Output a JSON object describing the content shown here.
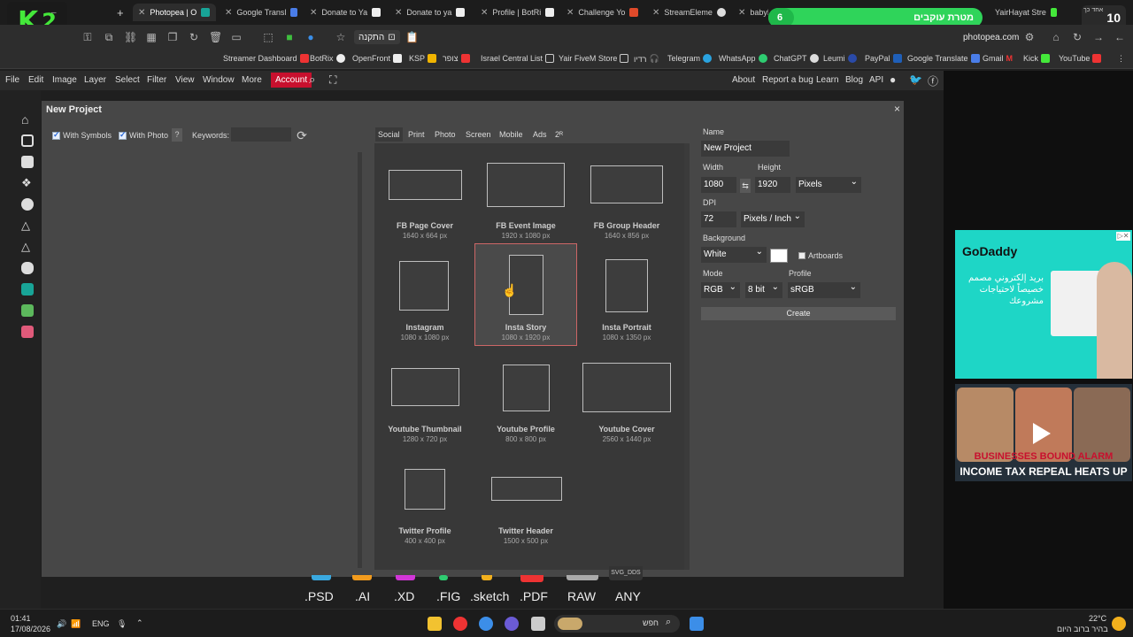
{
  "browser": {
    "tabs": [
      {
        "title": "Photopea | O",
        "active": true
      },
      {
        "title": "Google Transl"
      },
      {
        "title": "Donate to Ya"
      },
      {
        "title": "Donate to ya"
      },
      {
        "title": "Profile | BotRi"
      },
      {
        "title": "Challenge Yo"
      },
      {
        "title": "StreamEleme"
      },
      {
        "title": "babyM"
      },
      {
        "title": "YairHayat Stre"
      }
    ],
    "new_tab": "+",
    "url": "photopea.com",
    "install_button": "התקנה",
    "bookmarks": [
      "Streamer Dashboard",
      "BotRix",
      "OpenFront",
      "KSP",
      "צופר",
      "Israel Central List",
      "Yair FiveM Store",
      "רדיו",
      "Telegram",
      "WhatsApp",
      "ChatGPT",
      "Leumi",
      "PayPal",
      "Google Translate",
      "Gmail",
      "Kick",
      "YouTube"
    ]
  },
  "overlay": {
    "k2_letter": "K",
    "k2_number": "2",
    "goal_count": "6",
    "goal_label": "מטרת עוקבים",
    "goal_progress": 0.12,
    "badge_number": "10",
    "badge_label": "אחד כך"
  },
  "menu": {
    "items": [
      "File",
      "Edit",
      "Image",
      "Layer",
      "Select",
      "Filter",
      "View",
      "Window",
      "More"
    ],
    "account": "Account",
    "right_links": [
      "About",
      "Report a bug",
      "Learn",
      "Blog",
      "API"
    ]
  },
  "dialog": {
    "title": "New Project",
    "close": "×",
    "with_symbols": "With Symbols",
    "with_photo": "With Photo",
    "help": "?",
    "keywords_label": "Keywords:",
    "categories": [
      "Social",
      "Print",
      "Photo",
      "Screen",
      "Mobile",
      "Ads",
      "2ᴿ"
    ],
    "templates": [
      {
        "name": "FB Page Cover",
        "size": "1640 x 664 px"
      },
      {
        "name": "FB Event Image",
        "size": "1920 x 1080 px"
      },
      {
        "name": "FB Group Header",
        "size": "1640 x 856 px"
      },
      {
        "name": "Instagram",
        "size": "1080 x 1080 px"
      },
      {
        "name": "Insta Story",
        "size": "1080 x 1920 px",
        "selected": true
      },
      {
        "name": "Insta Portrait",
        "size": "1080 x 1350 px"
      },
      {
        "name": "Youtube Thumbnail",
        "size": "1280 x 720 px"
      },
      {
        "name": "Youtube Profile",
        "size": "800 x 800 px"
      },
      {
        "name": "Youtube Cover",
        "size": "2560 x 1440 px"
      },
      {
        "name": "Twitter Profile",
        "size": "400 x 400 px"
      },
      {
        "name": "Twitter Header",
        "size": "1500 x 500 px"
      }
    ],
    "form": {
      "name_label": "Name",
      "name_value": "New Project",
      "width_label": "Width",
      "width_value": "1080",
      "height_label": "Height",
      "height_value": "1920",
      "units": "Pixels",
      "dpi_label": "DPI",
      "dpi_value": "72",
      "dpi_units": "Pixels / Inch",
      "background_label": "Background",
      "background_value": "White",
      "artboards_label": "Artboards",
      "mode_label": "Mode",
      "mode_value": "RGB",
      "bit_value": "8 bit",
      "profile_label": "Profile",
      "profile_value": "sRGB",
      "create": "Create"
    }
  },
  "formats": [
    ".PSD",
    ".AI",
    ".XD",
    ".FIG",
    ".sketch",
    ".PDF",
    "RAW",
    "ANY"
  ],
  "format_top_label": "SVG_DDS",
  "ads": {
    "brand": "GoDaddy",
    "arabic_text": "بريد إلكتروني مصمم خصيصاً لاحتياجات مشروعك",
    "news_red": "BUSINESSES BOUND ALARM",
    "news_white": "INCOME TAX REPEAL HEATS UP"
  },
  "taskbar": {
    "time": "01:41",
    "date": "17/08/2026",
    "lang": "ENG",
    "search_placeholder": "חפש",
    "temperature": "22°C",
    "weather": "בהיר ברוב היום"
  }
}
